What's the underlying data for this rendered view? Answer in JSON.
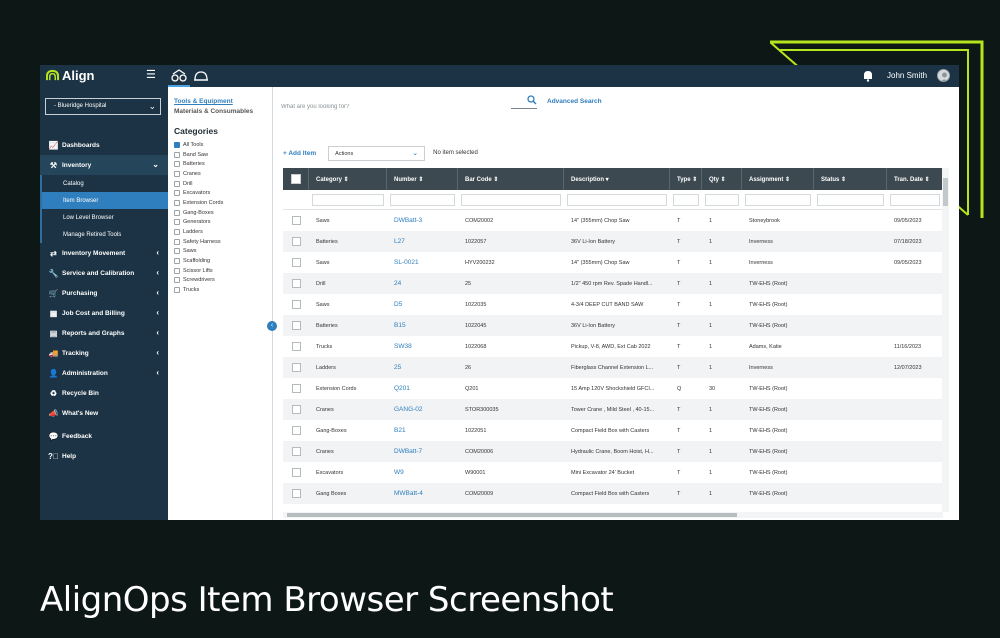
{
  "colors": {
    "brand_dark": "#1b3344",
    "accent": "#2f7ebd",
    "deco": "#b5e61d",
    "page_bg": "#0d1716"
  },
  "app": {
    "logo": "Align",
    "user": "John Smith"
  },
  "sidebar": {
    "location": "- Blueridge Hospital",
    "nav": [
      {
        "label": "Dashboards",
        "icon": "chart-icon"
      },
      {
        "label": "Inventory",
        "icon": "tools-icon"
      },
      {
        "label": "Inventory Movement",
        "icon": "swap-icon"
      },
      {
        "label": "Service and Calibration",
        "icon": "wrench-icon"
      },
      {
        "label": "Purchasing",
        "icon": "cart-icon"
      },
      {
        "label": "Job Cost and Billing",
        "icon": "calculator-icon"
      },
      {
        "label": "Reports and Graphs",
        "icon": "book-icon"
      },
      {
        "label": "Tracking",
        "icon": "truck-icon"
      },
      {
        "label": "Administration",
        "icon": "person-icon"
      },
      {
        "label": "Recycle Bin",
        "icon": "recycle-icon"
      },
      {
        "label": "What's New",
        "icon": "megaphone-icon"
      },
      {
        "label": "Feedback",
        "icon": "chat-icon"
      },
      {
        "label": "Help",
        "icon": "help-icon"
      }
    ],
    "inventory_sub": [
      "Catalog",
      "Item Browser",
      "Low Level Browser",
      "Manage Retired Tools"
    ]
  },
  "categories_panel": {
    "tab_tools": "Tools & Equipment",
    "tab_materials": "Materials & Consumables",
    "heading": "Categories",
    "items": [
      "All Tools",
      "Band Saw",
      "Batteries",
      "Cranes",
      "Drill",
      "Excavators",
      "Extension Cords",
      "Gang-Boxes",
      "Generators",
      "Ladders",
      "Safety Harness",
      "Saws",
      "Scaffolding",
      "Scissor Lifts",
      "Screwdrivers",
      "Trucks"
    ]
  },
  "search": {
    "placeholder": "What are you looking for?",
    "advanced": "Advanced Search"
  },
  "toolbar": {
    "add_item": "+ Add Item",
    "actions": "Actions",
    "no_selection": "No item selected"
  },
  "grid": {
    "columns": [
      "Category ⇕",
      "Number ⇕",
      "Bar Code ⇕",
      "Description ▾",
      "Type ⇕",
      "Qty ⇕",
      "Assignment ⇕",
      "Status ⇕",
      "Tran. Date ⇕"
    ],
    "rows": [
      [
        "Saws",
        "DWBatt-3",
        "COM20002",
        "14\" (355mm) Chop Saw",
        "T",
        "1",
        "Stoneybrook",
        "",
        "09/05/2023"
      ],
      [
        "Batteries",
        "L27",
        "1022057",
        "36V Li-Ion Battery",
        "T",
        "1",
        "Inverness",
        "",
        "07/18/2023"
      ],
      [
        "Saws",
        "SL-0021",
        "HYV200232",
        "14\" (355mm) Chop Saw",
        "T",
        "1",
        "Inverness",
        "",
        "09/05/2023"
      ],
      [
        "Drill",
        "24",
        "25",
        "1/2\" 450 rpm Rev. Spade Handl...",
        "T",
        "1",
        "TW-EHS (Root)",
        "",
        ""
      ],
      [
        "Saws",
        "D5",
        "1022035",
        "4-3/4 DEEP CUT BAND SAW",
        "T",
        "1",
        "TW-EHS (Root)",
        "",
        ""
      ],
      [
        "Batteries",
        "B15",
        "1022045",
        "36V Li-Ion Battery",
        "T",
        "1",
        "TW-EHS (Root)",
        "",
        ""
      ],
      [
        "Trucks",
        "SW38",
        "1022068",
        "Pickup, V-8, AWD, Ext Cab 2022",
        "T",
        "1",
        "Adams, Katie",
        "",
        "11/16/2023"
      ],
      [
        "Ladders",
        "25",
        "26",
        "Fiberglass Channel Extension L...",
        "T",
        "1",
        "Inverness",
        "",
        "12/07/2023"
      ],
      [
        "Extension Cords",
        "Q201",
        "Q201",
        "15 Amp 120V Shockshield GFCI...",
        "Q",
        "30",
        "TW-EHS (Root)",
        "",
        ""
      ],
      [
        "Cranes",
        "GANG-02",
        "STOR300035",
        "Tower Crane , Mild Steel , 40-15...",
        "T",
        "1",
        "TW-EHS (Root)",
        "",
        ""
      ],
      [
        "Gang-Boxes",
        "B21",
        "1022051",
        "Compact Field Box with Casters",
        "T",
        "1",
        "TW-EHS (Root)",
        "",
        ""
      ],
      [
        "Cranes",
        "DWBatt-7",
        "COM20006",
        "Hydraulic Crane, Boom Hoist, H...",
        "T",
        "1",
        "TW-EHS (Root)",
        "",
        ""
      ],
      [
        "Excavators",
        "W9",
        "W90001",
        "Mini Excavator 24' Bucket",
        "T",
        "1",
        "TW-EHS (Root)",
        "",
        ""
      ],
      [
        "Gang Boxes",
        "MWBatt-4",
        "COM20009",
        "Compact Field Box with Casters",
        "T",
        "1",
        "TW-EHS (Root)",
        "",
        ""
      ]
    ]
  },
  "caption": "AlignOps Item Browser Screenshot"
}
